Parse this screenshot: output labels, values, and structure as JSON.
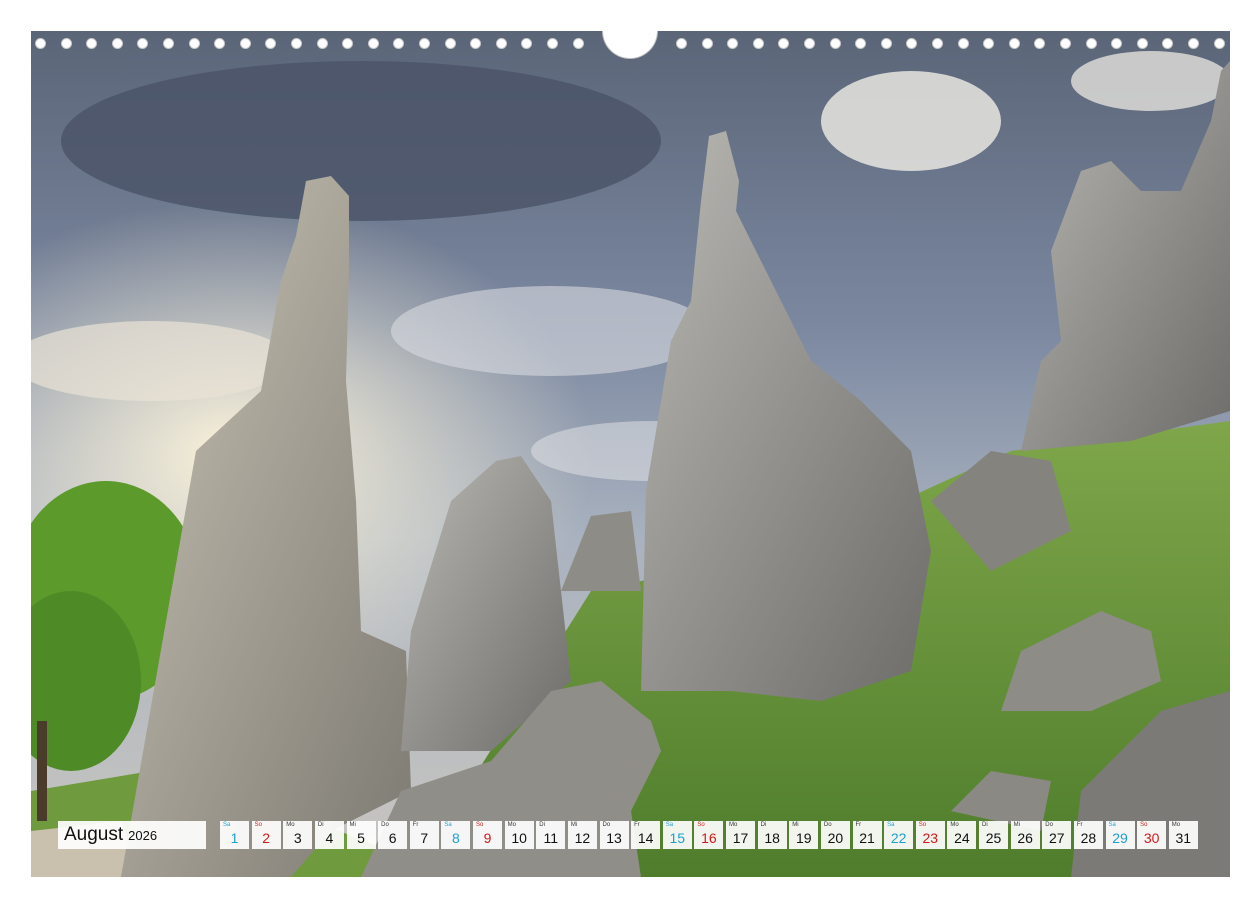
{
  "calendar": {
    "month": "August",
    "year": "2026",
    "days": [
      {
        "wd": "Sa",
        "d": "1",
        "type": "sat"
      },
      {
        "wd": "So",
        "d": "2",
        "type": "sun"
      },
      {
        "wd": "Mo",
        "d": "3",
        "type": "week"
      },
      {
        "wd": "Di",
        "d": "4",
        "type": "week"
      },
      {
        "wd": "Mi",
        "d": "5",
        "type": "week"
      },
      {
        "wd": "Do",
        "d": "6",
        "type": "week"
      },
      {
        "wd": "Fr",
        "d": "7",
        "type": "week"
      },
      {
        "wd": "Sa",
        "d": "8",
        "type": "sat"
      },
      {
        "wd": "So",
        "d": "9",
        "type": "sun"
      },
      {
        "wd": "Mo",
        "d": "10",
        "type": "week"
      },
      {
        "wd": "Di",
        "d": "11",
        "type": "week"
      },
      {
        "wd": "Mi",
        "d": "12",
        "type": "week"
      },
      {
        "wd": "Do",
        "d": "13",
        "type": "week"
      },
      {
        "wd": "Fr",
        "d": "14",
        "type": "week"
      },
      {
        "wd": "Sa",
        "d": "15",
        "type": "sat"
      },
      {
        "wd": "So",
        "d": "16",
        "type": "sun"
      },
      {
        "wd": "Mo",
        "d": "17",
        "type": "week"
      },
      {
        "wd": "Di",
        "d": "18",
        "type": "week"
      },
      {
        "wd": "Mi",
        "d": "19",
        "type": "week"
      },
      {
        "wd": "Do",
        "d": "20",
        "type": "week"
      },
      {
        "wd": "Fr",
        "d": "21",
        "type": "week"
      },
      {
        "wd": "Sa",
        "d": "22",
        "type": "sat"
      },
      {
        "wd": "So",
        "d": "23",
        "type": "sun"
      },
      {
        "wd": "Mo",
        "d": "24",
        "type": "week"
      },
      {
        "wd": "Di",
        "d": "25",
        "type": "week"
      },
      {
        "wd": "Mi",
        "d": "26",
        "type": "week"
      },
      {
        "wd": "Do",
        "d": "27",
        "type": "week"
      },
      {
        "wd": "Fr",
        "d": "28",
        "type": "week"
      },
      {
        "wd": "Sa",
        "d": "29",
        "type": "sat"
      },
      {
        "wd": "So",
        "d": "30",
        "type": "sun"
      },
      {
        "wd": "Mo",
        "d": "31",
        "type": "week"
      }
    ]
  },
  "colors": {
    "saturday": "#1e9fd0",
    "sunday": "#d21a1a",
    "weekday": "#111111"
  }
}
